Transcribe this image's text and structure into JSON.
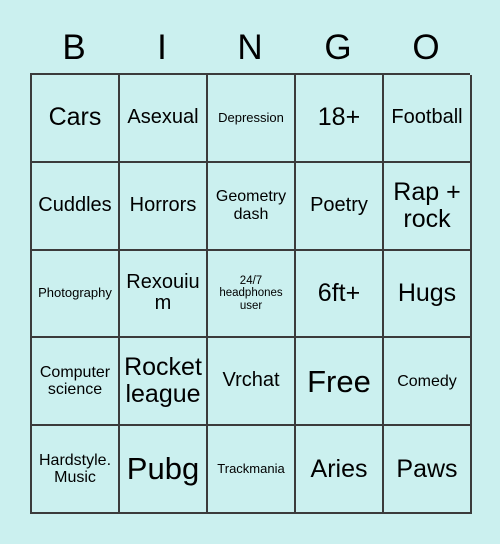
{
  "card": {
    "header_letters": [
      "B",
      "I",
      "N",
      "G",
      "O"
    ],
    "colors": {
      "background": "#cbf0ef",
      "cell_background": "#cbf0ef",
      "border": "#3b3b3b",
      "text": "#000000"
    },
    "rows": [
      [
        {
          "label": "Cars",
          "size": "lg"
        },
        {
          "label": "Asexual",
          "size": "md"
        },
        {
          "label": "Depression",
          "size": "xs"
        },
        {
          "label": "18+",
          "size": "lg"
        },
        {
          "label": "Football",
          "size": "md"
        }
      ],
      [
        {
          "label": "Cuddles",
          "size": "md"
        },
        {
          "label": "Horrors",
          "size": "md"
        },
        {
          "label": "Geometry dash",
          "size": "sm"
        },
        {
          "label": "Poetry",
          "size": "md"
        },
        {
          "label": "Rap + rock",
          "size": "lg"
        }
      ],
      [
        {
          "label": "Photography",
          "size": "xs"
        },
        {
          "label": "Rexouium",
          "size": "md"
        },
        {
          "label": "24/7 headphones user",
          "size": "xxs"
        },
        {
          "label": "6ft+",
          "size": "lg"
        },
        {
          "label": "Hugs",
          "size": "lg"
        }
      ],
      [
        {
          "label": "Computer science",
          "size": "sm"
        },
        {
          "label": "Rocket league",
          "size": "lg"
        },
        {
          "label": "Vrchat",
          "size": "md"
        },
        {
          "label": "Free",
          "size": "xl"
        },
        {
          "label": "Comedy",
          "size": "sm"
        }
      ],
      [
        {
          "label": "Hardstyle. Music",
          "size": "sm"
        },
        {
          "label": "Pubg",
          "size": "xl"
        },
        {
          "label": "Trackmania",
          "size": "xs"
        },
        {
          "label": "Aries",
          "size": "lg"
        },
        {
          "label": "Paws",
          "size": "lg"
        }
      ]
    ]
  }
}
